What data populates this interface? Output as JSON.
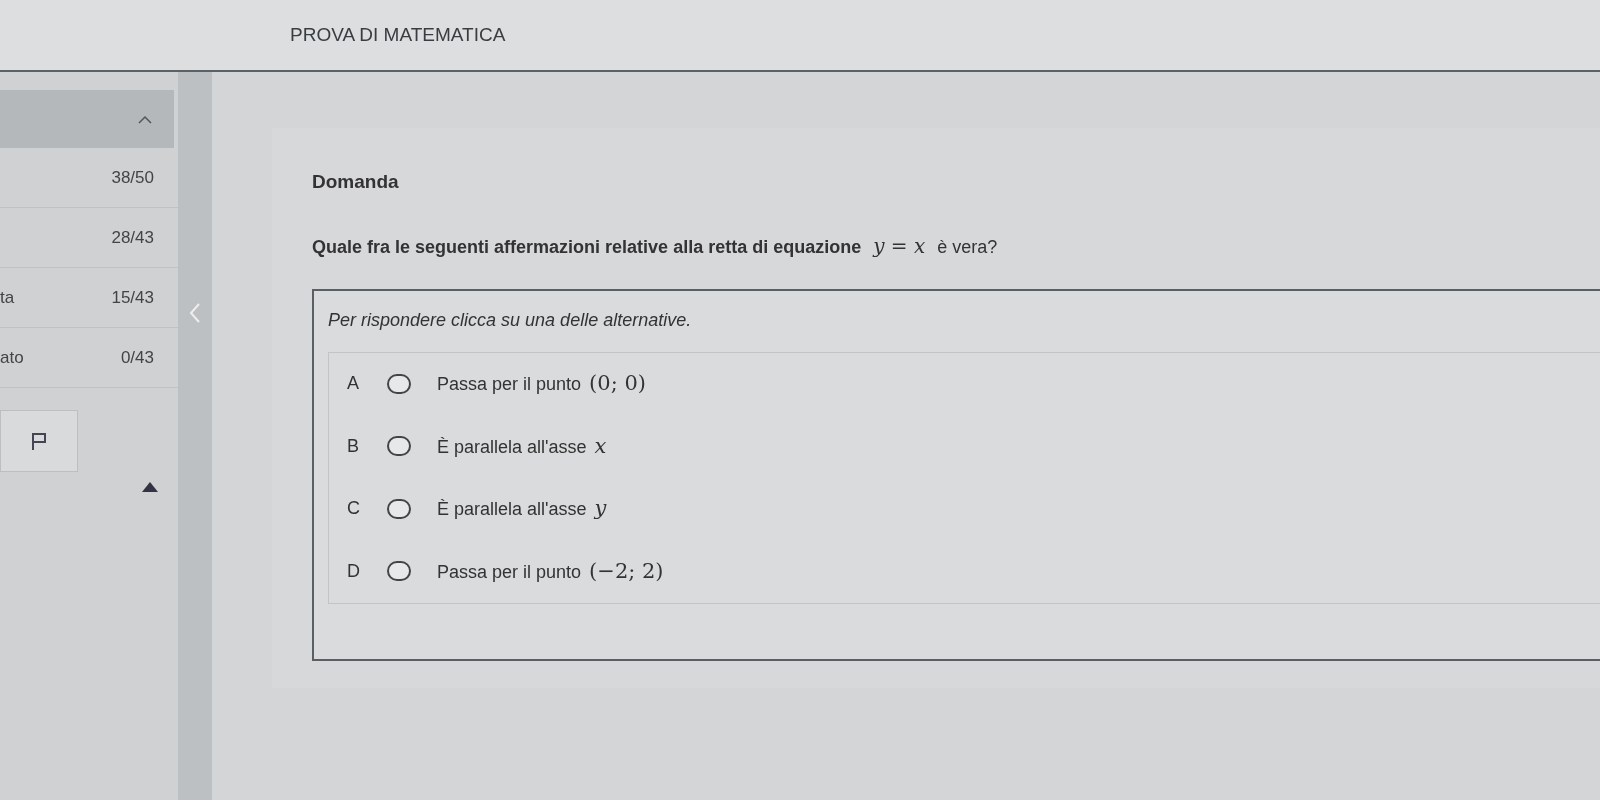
{
  "header": {
    "title": "PROVA DI MATEMATICA"
  },
  "sidebar": {
    "rows": [
      {
        "label": "",
        "count": "38/50"
      },
      {
        "label": "",
        "count": "28/43"
      },
      {
        "label": "ta",
        "count": "15/43"
      },
      {
        "label": "ato",
        "count": "0/43"
      }
    ]
  },
  "question": {
    "heading": "Domanda",
    "text": "Quale fra le seguenti affermazioni relative alla retta di equazione",
    "math": "*y* = *x*",
    "suffix": "è vera?"
  },
  "instructions": "Per rispondere clicca su una delle alternative.",
  "options": [
    {
      "letter": "A",
      "text": "Passa per il punto",
      "math": "(0; 0)",
      "selected": false
    },
    {
      "letter": "B",
      "text": "È parallela all'asse",
      "math": "*x*",
      "selected": false
    },
    {
      "letter": "C",
      "text": "È parallela all'asse",
      "math": "*y*",
      "selected": false
    },
    {
      "letter": "D",
      "text": "Passa per il punto",
      "math": "(−2; 2)",
      "selected": false
    }
  ]
}
